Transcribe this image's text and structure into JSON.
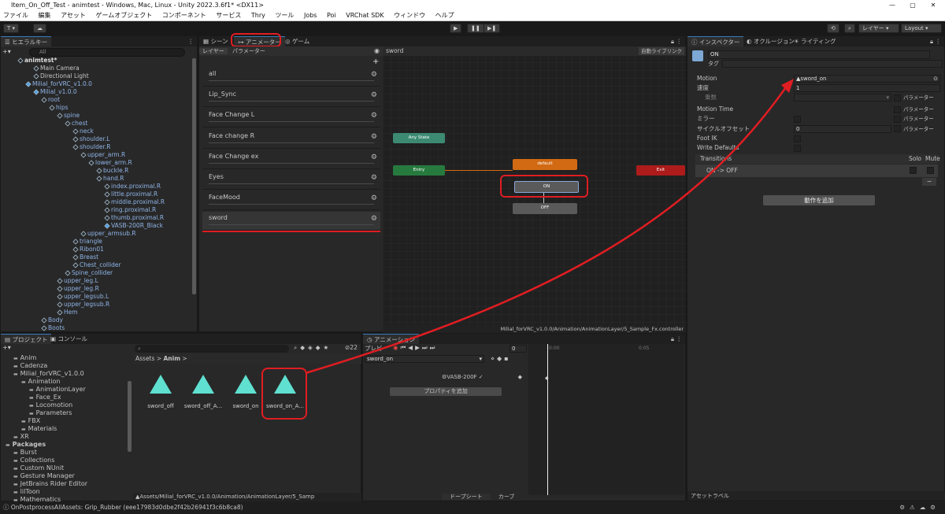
{
  "window": {
    "title": "Item_On_Off_Test - animtest - Windows, Mac, Linux - Unity 2022.3.6f1* <DX11>",
    "min": "—",
    "max": "▢",
    "close": "✕"
  },
  "menu": [
    "ファイル",
    "編集",
    "アセット",
    "ゲームオブジェクト",
    "コンポーネント",
    "サービス",
    "Thry",
    "ツール",
    "Jobs",
    "Poi",
    "VRChat SDK",
    "ウィンドウ",
    "ヘルプ"
  ],
  "toolbar": {
    "account": "T ▾",
    "play": "▶",
    "pause": "❚❚",
    "step": "▶❚",
    "layers": "レイヤー ▾",
    "layout": "Layout ▾"
  },
  "hierarchy": {
    "tab": "ヒエラルキー",
    "search_placeholder": "All",
    "add": "+▾",
    "rows": [
      {
        "label": "animtest*",
        "indent": 0,
        "kind": "scene"
      },
      {
        "label": "Main Camera",
        "indent": 2,
        "kind": "obj"
      },
      {
        "label": "Directional Light",
        "indent": 2,
        "kind": "obj"
      },
      {
        "label": "Milial_forVRC_v1.0.0",
        "indent": 1,
        "kind": "prefab"
      },
      {
        "label": "Milial_v1.0.0",
        "indent": 2,
        "kind": "prefab"
      },
      {
        "label": "root",
        "indent": 3,
        "kind": "bone"
      },
      {
        "label": "hips",
        "indent": 4,
        "kind": "bone"
      },
      {
        "label": "spine",
        "indent": 5,
        "kind": "bone"
      },
      {
        "label": "chest",
        "indent": 6,
        "kind": "bone"
      },
      {
        "label": "neck",
        "indent": 7,
        "kind": "bone"
      },
      {
        "label": "shoulder.L",
        "indent": 7,
        "kind": "bone"
      },
      {
        "label": "shoulder.R",
        "indent": 7,
        "kind": "bone"
      },
      {
        "label": "upper_arm.R",
        "indent": 8,
        "kind": "bone"
      },
      {
        "label": "lower_arm.R",
        "indent": 9,
        "kind": "bone"
      },
      {
        "label": "buckle.R",
        "indent": 10,
        "kind": "bone"
      },
      {
        "label": "hand.R",
        "indent": 10,
        "kind": "bone"
      },
      {
        "label": "index.proximal.R",
        "indent": 11,
        "kind": "bone"
      },
      {
        "label": "little.proximal.R",
        "indent": 11,
        "kind": "bone"
      },
      {
        "label": "middle.proximal.R",
        "indent": 11,
        "kind": "bone"
      },
      {
        "label": "ring.proximal.R",
        "indent": 11,
        "kind": "bone"
      },
      {
        "label": "thumb.proximal.R",
        "indent": 11,
        "kind": "bone"
      },
      {
        "label": "VASB-200R_Black",
        "indent": 11,
        "kind": "prefab"
      },
      {
        "label": "upper_armsub.R",
        "indent": 8,
        "kind": "bone"
      },
      {
        "label": "triangle",
        "indent": 7,
        "kind": "bone"
      },
      {
        "label": "Ribon01",
        "indent": 7,
        "kind": "bone"
      },
      {
        "label": "Breast",
        "indent": 7,
        "kind": "bone"
      },
      {
        "label": "Chest_collider",
        "indent": 7,
        "kind": "bone"
      },
      {
        "label": "Spine_collider",
        "indent": 6,
        "kind": "bone"
      },
      {
        "label": "upper_leg.L",
        "indent": 5,
        "kind": "bone"
      },
      {
        "label": "upper_leg.R",
        "indent": 5,
        "kind": "bone"
      },
      {
        "label": "upper_legsub.L",
        "indent": 5,
        "kind": "bone"
      },
      {
        "label": "upper_legsub.R",
        "indent": 5,
        "kind": "bone"
      },
      {
        "label": "Hem",
        "indent": 5,
        "kind": "bone"
      },
      {
        "label": "Body",
        "indent": 3,
        "kind": "bone"
      },
      {
        "label": "Boots",
        "indent": 3,
        "kind": "bone"
      }
    ]
  },
  "animator": {
    "tabs": [
      "シーン",
      "アニメーター",
      "ゲーム"
    ],
    "subtabs": [
      "レイヤー",
      "パラメーター"
    ],
    "breadcrumb": "sword",
    "auto_live": "自動ライブリンク",
    "layers": [
      "all",
      "Lip_Sync",
      "Face Change L",
      "Face change R",
      "Face Change ex",
      "Eyes",
      "FaceMood",
      "sword"
    ],
    "states": {
      "any": "Any State",
      "entry": "Entry",
      "default": "default",
      "exit": "Exit",
      "on": "ON",
      "off": "OFF"
    },
    "path": "Milial_forVRC_v1.0.0/Animation/AnimationLayer/5_Sample_Fx.controller"
  },
  "inspector": {
    "tabs": [
      "インスペクター",
      "オクルージョン",
      "ライティング"
    ],
    "name": "ON",
    "tag_label": "タグ",
    "motion_label": "Motion",
    "motion_value": "sword_on",
    "speed_label": "速度",
    "speed_value": "1",
    "multiplier_label": "乗数",
    "param_label": "パラメーター",
    "motion_time": "Motion Time",
    "mirror": "ミラー",
    "cycle_offset": "サイクルオフセット",
    "cycle_value": "0",
    "foot_ik": "Foot IK",
    "write_defaults": "Write Defaults",
    "transitions": "Transitions",
    "solo": "Solo",
    "mute": "Mute",
    "transition_item": "ON -> OFF",
    "remove": "−",
    "add_behaviour": "動作を追加",
    "asset_label": "アセットラベル"
  },
  "project": {
    "tabs": [
      "プロジェクト",
      "コンソール"
    ],
    "count": "22",
    "breadcrumb": [
      "Assets",
      ">",
      "Anim",
      ">"
    ],
    "folders": [
      {
        "label": "Anim",
        "indent": 1
      },
      {
        "label": "Cadenza",
        "indent": 1
      },
      {
        "label": "Milial_forVRC_v1.0.0",
        "indent": 1
      },
      {
        "label": "Animation",
        "indent": 2
      },
      {
        "label": "AnimationLayer",
        "indent": 3
      },
      {
        "label": "Face_Ex",
        "indent": 3
      },
      {
        "label": "Locomotion",
        "indent": 3
      },
      {
        "label": "Parameters",
        "indent": 3
      },
      {
        "label": "FBX",
        "indent": 2
      },
      {
        "label": "Materials",
        "indent": 2
      },
      {
        "label": "XR",
        "indent": 1
      },
      {
        "label": "Packages",
        "indent": 0
      },
      {
        "label": "Burst",
        "indent": 1
      },
      {
        "label": "Collections",
        "indent": 1
      },
      {
        "label": "Custom NUnit",
        "indent": 1
      },
      {
        "label": "Gesture Manager",
        "indent": 1
      },
      {
        "label": "JetBrains Rider Editor",
        "indent": 1
      },
      {
        "label": "lilToon",
        "indent": 1
      },
      {
        "label": "Mathematics",
        "indent": 1
      }
    ],
    "assets": [
      "sword_off",
      "sword_off_A...",
      "sword_on",
      "sword_on_A..."
    ],
    "footer_path": "Assets/Milial_forVRC_v1.0.0/Animation/AnimationLayer/5_Samp"
  },
  "animation": {
    "tab": "アニメーション",
    "preview": "プレビ",
    "frame": "0",
    "clip": "sword_on",
    "property": "VASB-200F",
    "add_property": "プロパティを追加",
    "dopesheet": "ドープシート",
    "curves": "カーブ",
    "ticks": [
      "0:00",
      "0:05"
    ]
  },
  "status": {
    "text": "OnPostprocessAllAssets: Grip_Rubber (eee17983d0dbe2f42b26941f3c6b8ca8)"
  },
  "colors": {
    "highlight": "#e01d22",
    "state_orange": "#d26a14",
    "state_green": "#3c8a72",
    "state_entry": "#277a3e",
    "state_exit": "#ad1b1b",
    "state_gray": "#5a5a5a",
    "clip_icon": "#5fe0d0",
    "bone_text": "#8fb3e6"
  }
}
